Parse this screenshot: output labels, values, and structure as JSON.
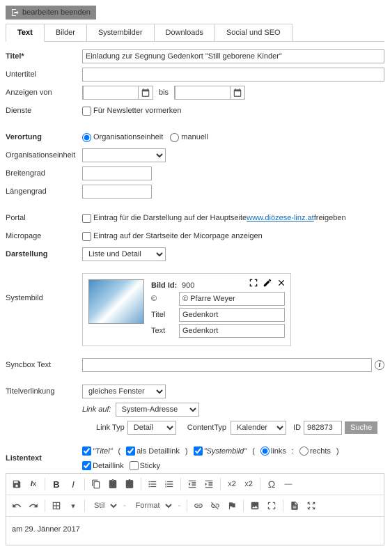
{
  "exit_label": "bearbeiten beenden",
  "tabs": [
    "Text",
    "Bilder",
    "Systembilder",
    "Downloads",
    "Social und SEO"
  ],
  "fields": {
    "titel_label": "Titel*",
    "titel_value": "Einladung zur Segnung Gedenkort \"Still geborene Kinder\"",
    "untertitel_label": "Untertitel",
    "untertitel_value": "",
    "anzeigen_von_label": "Anzeigen von",
    "bis_label": "bis",
    "dienste_label": "Dienste",
    "newsletter_label": "Für Newsletter vormerken",
    "verortung_label": "Verortung",
    "verortung_opt1": "Organisationseinheit",
    "verortung_opt2": "manuell",
    "org_label": "Organisationseinheit",
    "breitengrad_label": "Breitengrad",
    "laengengrad_label": "Längengrad",
    "portal_label": "Portal",
    "portal_text1": "Eintrag für die Darstellung auf der Hauptseite ",
    "portal_link": "www.diözese-linz.at",
    "portal_text2": " freigeben",
    "micropage_label": "Micropage",
    "micropage_text": "Eintrag auf der Startseite der Micorpage anzeigen",
    "darstellung_label": "Darstellung",
    "darstellung_value": "Liste und Detail",
    "systembild_label": "Systembild",
    "bild_id_label": "Bild Id:",
    "bild_id_value": "900",
    "copyright_label": "©",
    "copyright_value": "© Pfarre Weyer",
    "bild_titel_label": "Titel",
    "bild_titel_value": "Gedenkort",
    "bild_text_label": "Text",
    "bild_text_value": "Gedenkort",
    "syncbox_label": "Syncbox Text",
    "titelverlinkung_label": "Titelverlinkung",
    "titelverlinkung_value": "gleiches Fenster",
    "linkauf_label": "Link auf:",
    "linkauf_value": "System-Adresse",
    "linktyp_label": "Link Typ",
    "linktyp_value": "Detail",
    "contenttyp_label": "ContentTyp",
    "contenttyp_value": "Kalender",
    "id_label": "ID",
    "id_value": "982873",
    "suche_label": "Suche",
    "listentext_label": "Listentext",
    "opt_titel": "\"Titel\"",
    "opt_detaillink1": "als Detaillink",
    "opt_systembild": "\"Systembild\"",
    "opt_links": "links",
    "opt_rechts": "rechts",
    "opt_detaillink2": "Detaillink",
    "opt_sticky": "Sticky",
    "stil_label": "Stil",
    "format_label": "Format",
    "editor_content": "am 29. Jänner 2017"
  }
}
